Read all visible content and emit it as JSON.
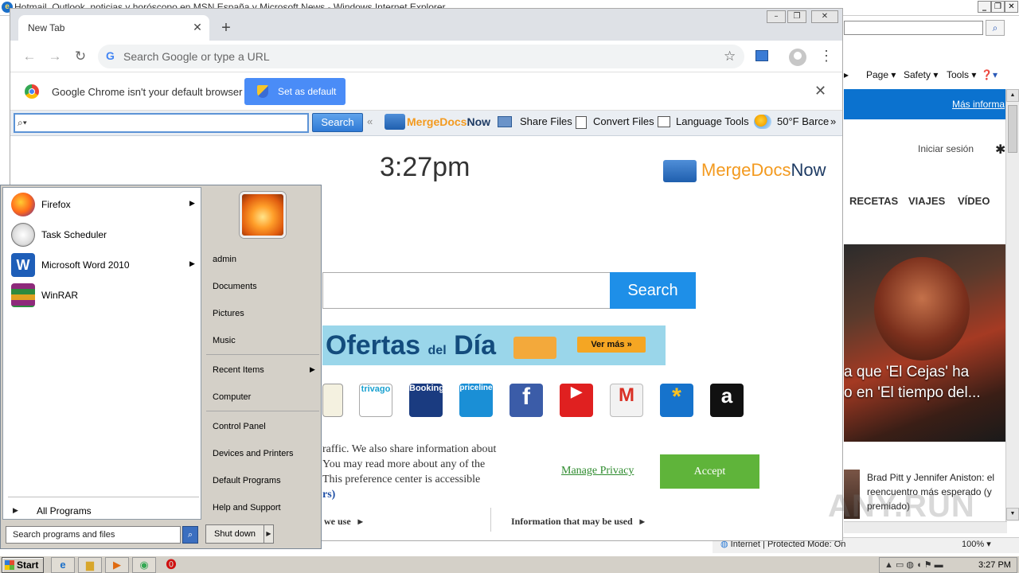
{
  "ie": {
    "title": "Hotmail, Outlook, noticias y horóscopo en MSN España y Microsoft News - Windows Internet Explorer",
    "command_bar": [
      "Page",
      "Safety",
      "Tools"
    ],
    "mas_link": "Más informa",
    "login": "Iniciar sesión",
    "nav": [
      "RECETAS",
      "VIAJES",
      "VÍDEO"
    ],
    "headline": "a que 'El Cejas' ha\no en 'El tiempo del...",
    "news2": "Brad Pitt y Jennifer Aniston: el reencuentro más esperado (y premiado)",
    "status_zone": "Internet | Protected Mode: On",
    "zoom": "100%"
  },
  "chrome": {
    "tab_title": "New Tab",
    "omnibox_placeholder": "Search Google or type a URL",
    "infobar_text": "Google Chrome isn't your default browser",
    "set_default_label": "Set as default"
  },
  "mergedocs_bar": {
    "search_label": "Search",
    "brand": {
      "merge": "MergeDocs",
      "now": "Now"
    },
    "items": [
      "Share Files",
      "Convert Files",
      "Language Tools",
      "50°F Barce"
    ]
  },
  "page": {
    "time": "3:27pm",
    "brand": {
      "merge": "MergeDocs",
      "now": "Now"
    },
    "search_button": "Search",
    "banner": {
      "title": "Ofertas",
      "del": "del",
      "dia": "Día",
      "button": "Ver más »"
    },
    "tiles": [
      "trivago",
      "Booking",
      "priceline",
      "f",
      "▶",
      "M",
      "*",
      "a"
    ],
    "cookie_text": "raffic. We also share information about\n You may read more about any of the\n This preference center is accessible",
    "cookie_tail": "rs)",
    "manage_privacy": "Manage Privacy",
    "accept": "Accept",
    "we_use": "we use",
    "info_used": "Information that may be used"
  },
  "start_menu": {
    "programs": [
      {
        "label": "Firefox",
        "color": "#e8631e"
      },
      {
        "label": "Task Scheduler",
        "color": "#c9c9c9"
      },
      {
        "label": "Microsoft Word 2010",
        "color": "#1e5eb8"
      },
      {
        "label": "WinRAR",
        "color": "#8e2a7b"
      }
    ],
    "all_programs": "All Programs",
    "search_placeholder": "Search programs and files",
    "right_items": [
      "admin",
      "Documents",
      "Pictures",
      "Music",
      "Recent Items",
      "Computer",
      "Control Panel",
      "Devices and Printers",
      "Default Programs",
      "Help and Support"
    ],
    "shutdown": "Shut down"
  },
  "taskbar": {
    "start": "Start",
    "time": "3:27 PM"
  },
  "watermark": "ANY.RUN",
  "colors": {
    "chrome_blue": "#4a8cf7",
    "page_search_blue": "#1e8fe8",
    "accept_green": "#5fb43a",
    "msn_blue": "#0b72cf",
    "mergedocs_orange": "#f39a1f",
    "mergedocs_navy": "#1d3a63"
  }
}
